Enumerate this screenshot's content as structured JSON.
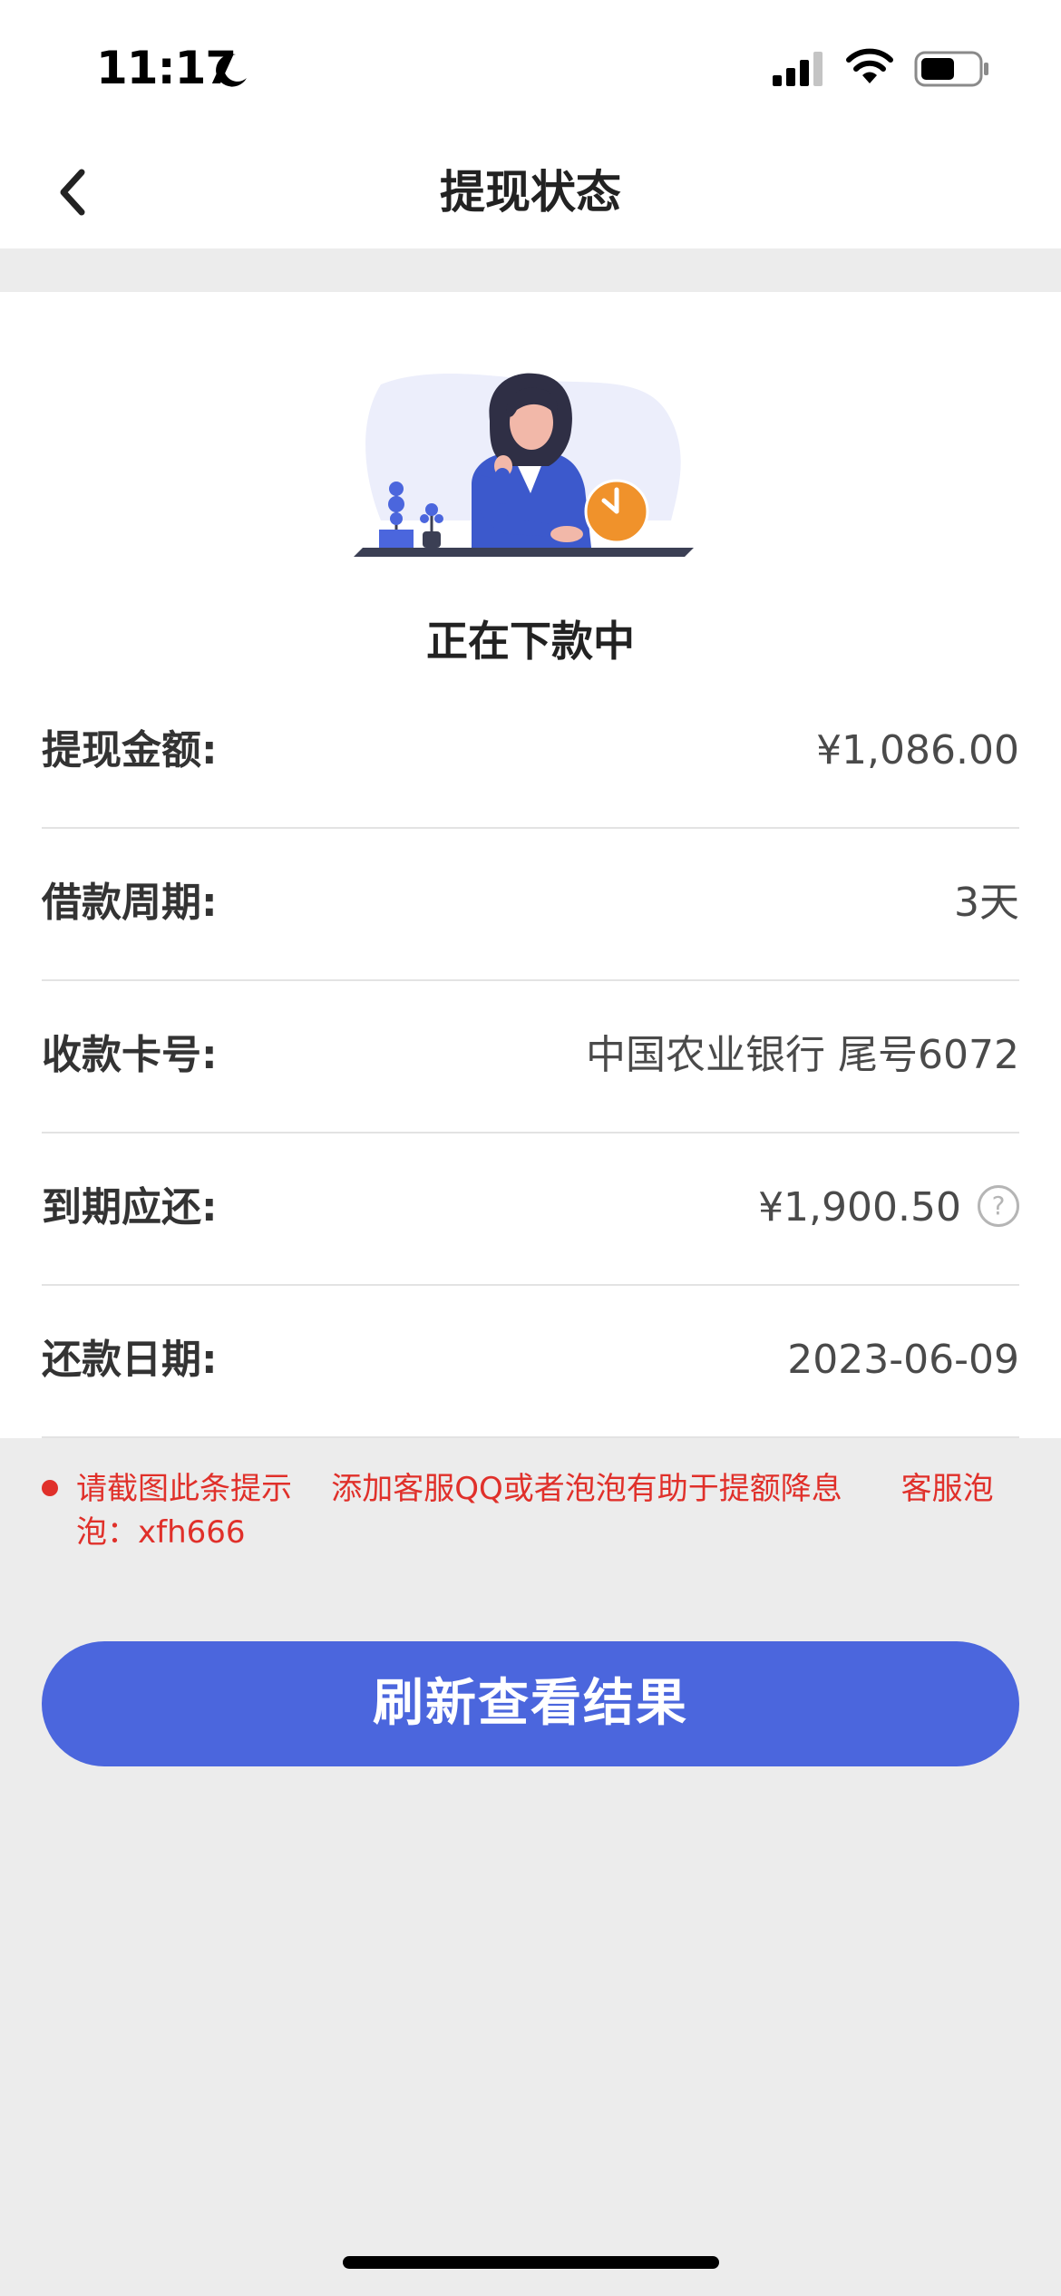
{
  "status_bar": {
    "time": "11:17"
  },
  "nav": {
    "title": "提现状态"
  },
  "status": {
    "text": "正在下款中"
  },
  "info_rows": [
    {
      "label": "提现金额:",
      "value": "¥1,086.00"
    },
    {
      "label": "借款周期:",
      "value": "3天"
    },
    {
      "label": "收款卡号:",
      "value": "中国农业银行  尾号6072"
    },
    {
      "label": "到期应还:",
      "value": "¥1,900.50"
    },
    {
      "label": "还款日期:",
      "value": "2023-06-09"
    }
  ],
  "notice": {
    "text": "请截图此条提示    添加客服QQ或者泡泡有助于提额降息      客服泡泡：xfh666"
  },
  "refresh_button": {
    "label": "刷新查看结果"
  },
  "colors": {
    "accent": "#4b66dd",
    "notice": "#e0302a",
    "clock_badge": "#f0922b"
  },
  "icons": {
    "back": "chevron-left-icon",
    "help": "question-circle-icon",
    "moon": "moon-icon",
    "signal": "signal-icon",
    "wifi": "wifi-icon",
    "battery": "battery-icon"
  }
}
